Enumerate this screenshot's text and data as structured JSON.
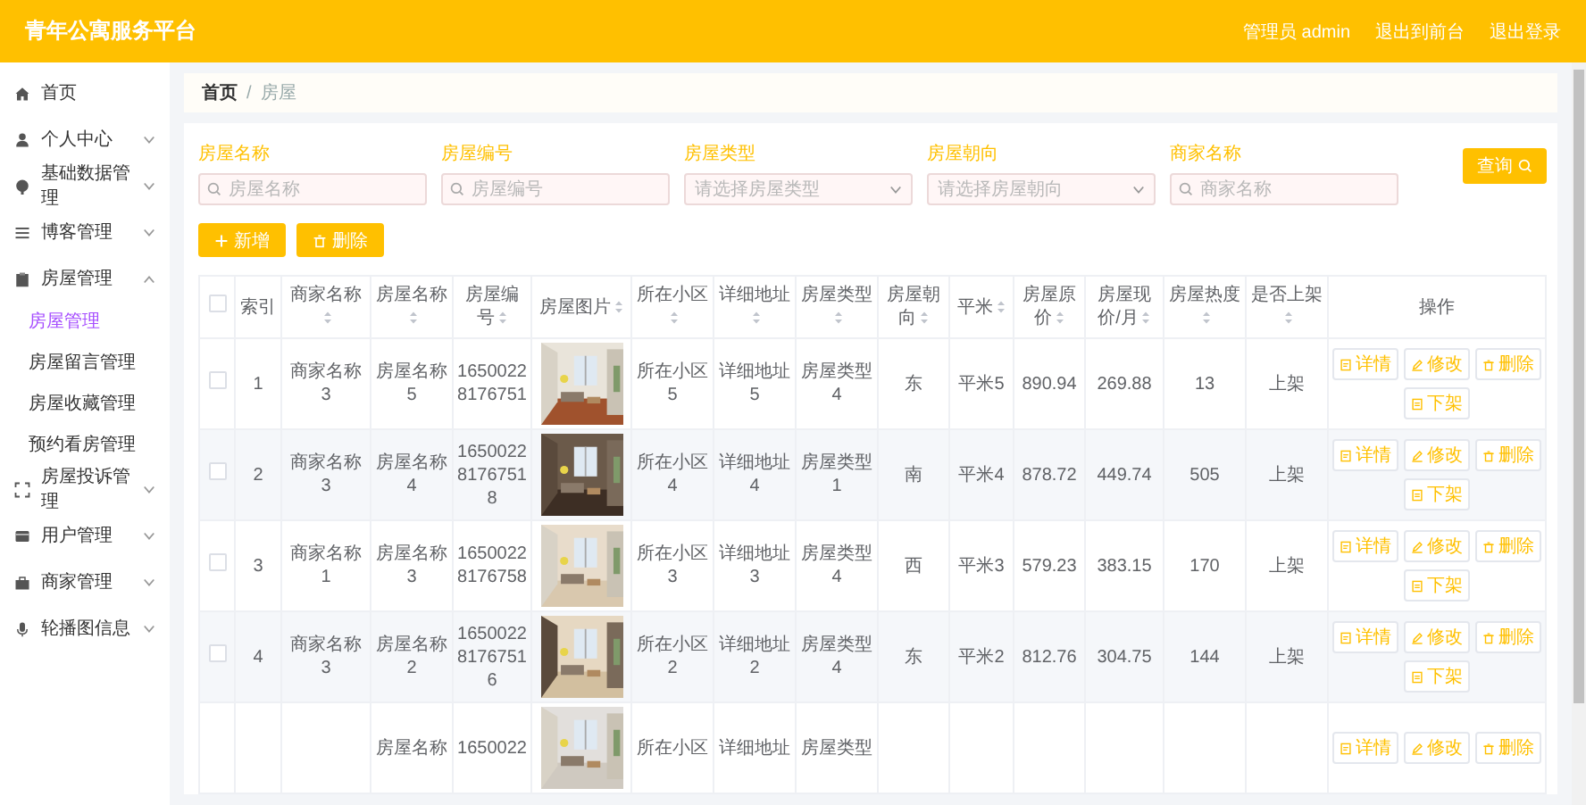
{
  "header": {
    "title": "青年公寓服务平台",
    "user": "管理员 admin",
    "links": [
      "退出到前台",
      "退出登录"
    ]
  },
  "sidebar": {
    "items": [
      {
        "label": "首页"
      },
      {
        "label": "个人中心",
        "expanded": false
      },
      {
        "label": "基础数据管理",
        "expanded": false
      },
      {
        "label": "博客管理",
        "expanded": false
      },
      {
        "label": "房屋管理",
        "expanded": true,
        "children": [
          {
            "label": "房屋管理",
            "selected": true
          },
          {
            "label": "房屋留言管理",
            "selected": false
          },
          {
            "label": "房屋收藏管理",
            "selected": false
          },
          {
            "label": "预约看房管理",
            "selected": false
          }
        ]
      },
      {
        "label": "房屋投诉管理",
        "expanded": false
      },
      {
        "label": "用户管理",
        "expanded": false
      },
      {
        "label": "商家管理",
        "expanded": false
      },
      {
        "label": "轮播图信息",
        "expanded": false
      }
    ]
  },
  "breadcrumb": {
    "items": [
      "首页",
      "房屋"
    ],
    "separator": "/"
  },
  "filters": [
    {
      "kind": "input",
      "label": "房屋名称",
      "placeholder": "房屋名称"
    },
    {
      "kind": "input",
      "label": "房屋编号",
      "placeholder": "房屋编号"
    },
    {
      "kind": "select",
      "label": "房屋类型",
      "placeholder": "请选择房屋类型"
    },
    {
      "kind": "select",
      "label": "房屋朝向",
      "placeholder": "请选择房屋朝向"
    },
    {
      "kind": "input",
      "label": "商家名称",
      "placeholder": "商家名称"
    }
  ],
  "query_button": "查询",
  "toolbar": {
    "add": "新增",
    "delete": "删除"
  },
  "table": {
    "columns": [
      {
        "label": "索引",
        "sortable": false
      },
      {
        "label": "商家名称",
        "sortable": true
      },
      {
        "label": "房屋名称",
        "sortable": true
      },
      {
        "label": "房屋编号",
        "sortable": true
      },
      {
        "label": "房屋图片",
        "sortable": true
      },
      {
        "label": "所在小区",
        "sortable": true
      },
      {
        "label": "详细地址",
        "sortable": true
      },
      {
        "label": "房屋类型",
        "sortable": true
      },
      {
        "label": "房屋朝向",
        "sortable": true
      },
      {
        "label": "平米",
        "sortable": true
      },
      {
        "label": "房屋原价",
        "sortable": true
      },
      {
        "label": "房屋现价/月",
        "sortable": true
      },
      {
        "label": "房屋热度",
        "sortable": true
      },
      {
        "label": "是否上架",
        "sortable": true
      },
      {
        "label": "操作",
        "sortable": false
      }
    ],
    "header_checked": false,
    "rows": [
      {
        "checked": false,
        "cells": [
          "1",
          "商家名称3",
          "房屋名称5",
          "16500228176751",
          {
            "kind": "picture"
          },
          "所在小区5",
          "详细地址5",
          "房屋类型4",
          "东",
          "平米5",
          "890.94",
          "269.88",
          "13",
          "上架"
        ],
        "actions": [
          "详情",
          "修改",
          "删除",
          "下架"
        ]
      },
      {
        "checked": false,
        "cells": [
          "2",
          "商家名称3",
          "房屋名称4",
          "165002281767518",
          {
            "kind": "picture"
          },
          "所在小区4",
          "详细地址4",
          "房屋类型1",
          "南",
          "平米4",
          "878.72",
          "449.74",
          "505",
          "上架"
        ],
        "actions": [
          "详情",
          "修改",
          "删除",
          "下架"
        ]
      },
      {
        "checked": false,
        "cells": [
          "3",
          "商家名称1",
          "房屋名称3",
          "16500228176758",
          {
            "kind": "picture"
          },
          "所在小区3",
          "详细地址3",
          "房屋类型4",
          "西",
          "平米3",
          "579.23",
          "383.15",
          "170",
          "上架"
        ],
        "actions": [
          "详情",
          "修改",
          "删除",
          "下架"
        ]
      },
      {
        "checked": false,
        "cells": [
          "4",
          "商家名称3",
          "房屋名称2",
          "165002281767516",
          {
            "kind": "picture"
          },
          "所在小区2",
          "详细地址2",
          "房屋类型4",
          "东",
          "平米2",
          "812.76",
          "304.75",
          "144",
          "上架"
        ],
        "actions": [
          "详情",
          "修改",
          "删除",
          "下架"
        ]
      },
      {
        "cells": [
          "",
          "",
          "房屋名称",
          "1650022",
          {
            "kind": "picture"
          },
          "所在小区",
          "详细地址",
          "房屋类型",
          "",
          "",
          "",
          "",
          "",
          ""
        ],
        "actions": [
          "详情",
          "修改",
          "删除"
        ]
      }
    ]
  }
}
